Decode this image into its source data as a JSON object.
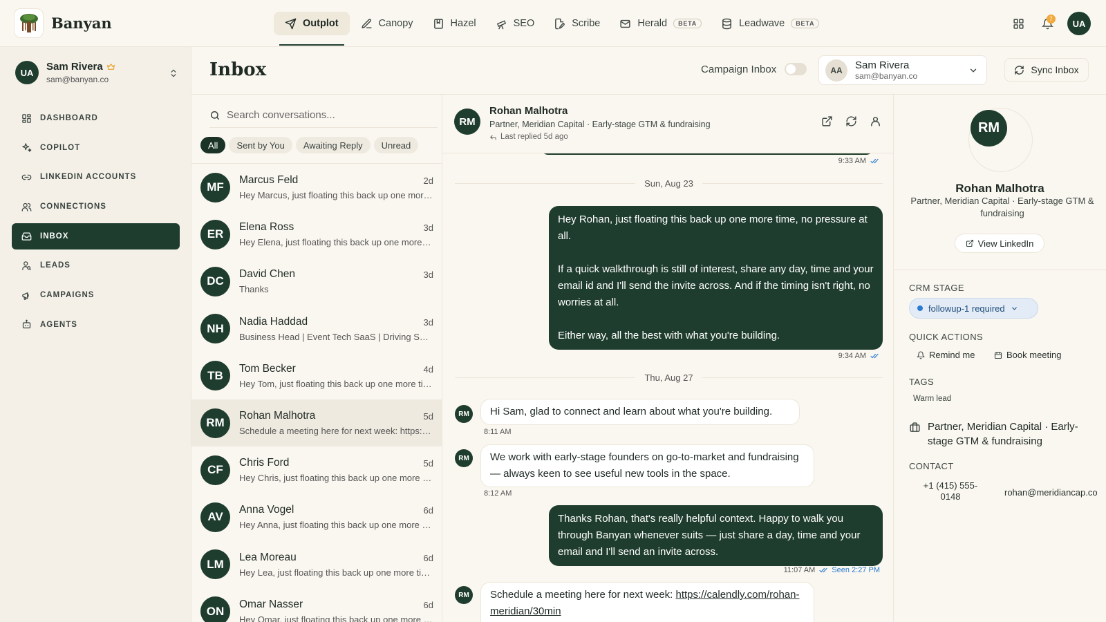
{
  "app": {
    "name": "Banyan"
  },
  "topnav": {
    "tabs": [
      {
        "label": "Outplot",
        "icon": "send-icon",
        "active": true
      },
      {
        "label": "Canopy",
        "icon": "edit-icon"
      },
      {
        "label": "Hazel",
        "icon": "book-icon"
      },
      {
        "label": "SEO",
        "icon": "telescope-icon"
      },
      {
        "label": "Scribe",
        "icon": "file-pen-icon"
      },
      {
        "label": "Herald",
        "icon": "mail-icon",
        "badge": "BETA"
      },
      {
        "label": "Leadwave",
        "icon": "database-icon",
        "badge": "BETA"
      }
    ],
    "notification_count": "7",
    "user_initials": "UA"
  },
  "sidebar": {
    "user": {
      "initials": "UA",
      "name": "Sam Rivera",
      "email": "sam@banyan.co"
    },
    "items": [
      {
        "label": "DASHBOARD",
        "icon": "dashboard-icon"
      },
      {
        "label": "COPILOT",
        "icon": "sparkles-icon"
      },
      {
        "label": "LINKEDIN ACCOUNTS",
        "icon": "link-icon"
      },
      {
        "label": "CONNECTIONS",
        "icon": "users-icon"
      },
      {
        "label": "INBOX",
        "icon": "inbox-icon",
        "active": true
      },
      {
        "label": "LEADS",
        "icon": "user-search-icon"
      },
      {
        "label": "CAMPAIGNS",
        "icon": "megaphone-icon"
      },
      {
        "label": "AGENTS",
        "icon": "bot-icon"
      }
    ]
  },
  "header": {
    "title": "Inbox",
    "campaign_inbox_label": "Campaign Inbox",
    "account": {
      "initials": "AA",
      "name": "Sam Rivera",
      "email": "sam@banyan.co"
    },
    "sync_label": "Sync Inbox"
  },
  "conversations": {
    "search_placeholder": "Search conversations...",
    "filters": [
      "All",
      "Sent by You",
      "Awaiting Reply",
      "Unread"
    ],
    "items": [
      {
        "initials": "MF",
        "name": "Marcus Feld",
        "time": "2d",
        "preview": "Hey Marcus, just floating this back up one more time, no pressure at all."
      },
      {
        "initials": "ER",
        "name": "Elena Ross",
        "time": "3d",
        "preview": "Hey Elena, just floating this back up one more time, no pressure at all."
      },
      {
        "initials": "DC",
        "name": "David Chen",
        "time": "3d",
        "preview": "Thanks"
      },
      {
        "initials": "NH",
        "name": "Nadia Haddad",
        "time": "3d",
        "preview": "Business Head | Event Tech SaaS | Driving Sales"
      },
      {
        "initials": "TB",
        "name": "Tom Becker",
        "time": "4d",
        "preview": "Hey Tom, just floating this back up one more time, no pressure at all."
      },
      {
        "initials": "RM",
        "name": "Rohan Malhotra",
        "time": "5d",
        "preview": "Schedule a meeting here for next week: https://calendly.com/rohan-meridian/30min",
        "active": true
      },
      {
        "initials": "CF",
        "name": "Chris Ford",
        "time": "5d",
        "preview": "Hey Chris, just floating this back up one more time, no pressure at all."
      },
      {
        "initials": "AV",
        "name": "Anna Vogel",
        "time": "6d",
        "preview": "Hey Anna, just floating this back up one more time, no pressure at all."
      },
      {
        "initials": "LM",
        "name": "Lea Moreau",
        "time": "6d",
        "preview": "Hey Lea, just floating this back up one more time, no pressure at all."
      },
      {
        "initials": "ON",
        "name": "Omar Nasser",
        "time": "6d",
        "preview": "Hey Omar, just floating this back up one more time, no pressure at all."
      }
    ]
  },
  "thread": {
    "contact": {
      "initials": "RM",
      "name": "Rohan Malhotra",
      "headline": "Partner, Meridian Capital · Early-stage GTM & fundraising",
      "last_replied": "Last replied 5d ago"
    },
    "top_time": "9:33 AM",
    "date1": "Sun, Aug 23",
    "msg1": {
      "p1": "Hey Rohan, just floating this back up one more time, no pressure at all.",
      "p2": "If a quick walkthrough is still of interest, share any day, time and your email id and I'll send the invite across. And if the timing isn't right, no worries at all.",
      "p3": "Either way, all the best with what you're building.",
      "time": "9:34 AM"
    },
    "date2": "Thu, Aug 27",
    "msg2": {
      "text": "Hi Sam, glad to connect and learn about what you're building.",
      "time": "8:11 AM"
    },
    "msg3": {
      "text": "We work with early-stage founders on go-to-market and fundraising — always keen to see useful new tools in the space.",
      "time": "8:12 AM"
    },
    "msg4": {
      "text": "Thanks Rohan, that's really helpful context. Happy to walk you through Banyan whenever suits — just share a day, time and your email and I'll send an invite across.",
      "time": "11:07 AM",
      "seen": "Seen 2:27 PM"
    },
    "msg5": {
      "prefix": "Schedule a meeting here for next week:",
      "link": "https://calendly.com/rohan-meridian/30min"
    }
  },
  "details": {
    "initials": "RM",
    "name": "Rohan Malhotra",
    "headline": "Partner, Meridian Capital · Early-stage GTM & fundraising",
    "view_linkedin": "View LinkedIn",
    "crm_stage_label": "CRM STAGE",
    "crm_stage": "followup-1 required",
    "quick_actions_label": "QUICK ACTIONS",
    "remind": "Remind me",
    "book": "Book meeting",
    "tags_label": "TAGS",
    "tag": "Warm lead",
    "experience": "Partner, Meridian Capital · Early-stage GTM & fundraising",
    "contact_label": "CONTACT",
    "phone": "+1 (415) 555-0148",
    "email": "rohan@meridiancap.co"
  },
  "colors": {
    "brand": "#1f3d2e",
    "accent": "#2d7bd1",
    "background": "#faf7f0"
  }
}
